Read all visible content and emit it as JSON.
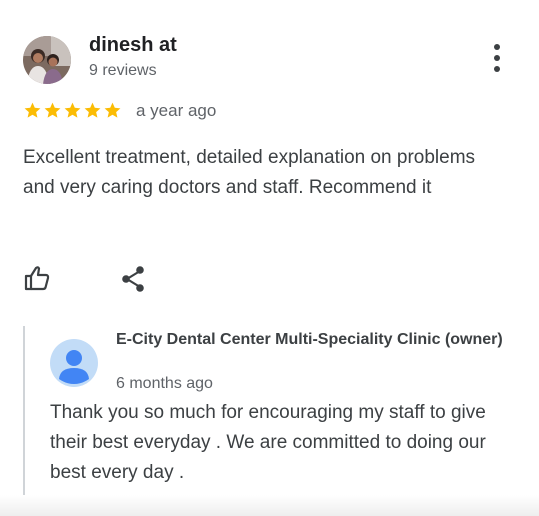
{
  "review": {
    "author_name": "dinesh at",
    "review_count": "9 reviews",
    "rating": 5,
    "rating_max": 5,
    "date": "a year ago",
    "text": "Excellent treatment, detailed explanation on problems and very caring doctors and staff. Recommend it",
    "star_color": "#fbbc04"
  },
  "actions": {
    "like_icon": "thumbs-up-icon",
    "share_icon": "share-icon",
    "more_icon": "more-vertical-icon"
  },
  "owner_reply": {
    "name": "E-City Dental Center Multi-Speciality Clinic (owner)",
    "date": "6 months ago",
    "text": "Thank you so much for encouraging my staff to give their best everyday . We are committed to doing our best every day .",
    "avatar_color": "#4285f4",
    "avatar_bg": "#c2dcf7"
  }
}
